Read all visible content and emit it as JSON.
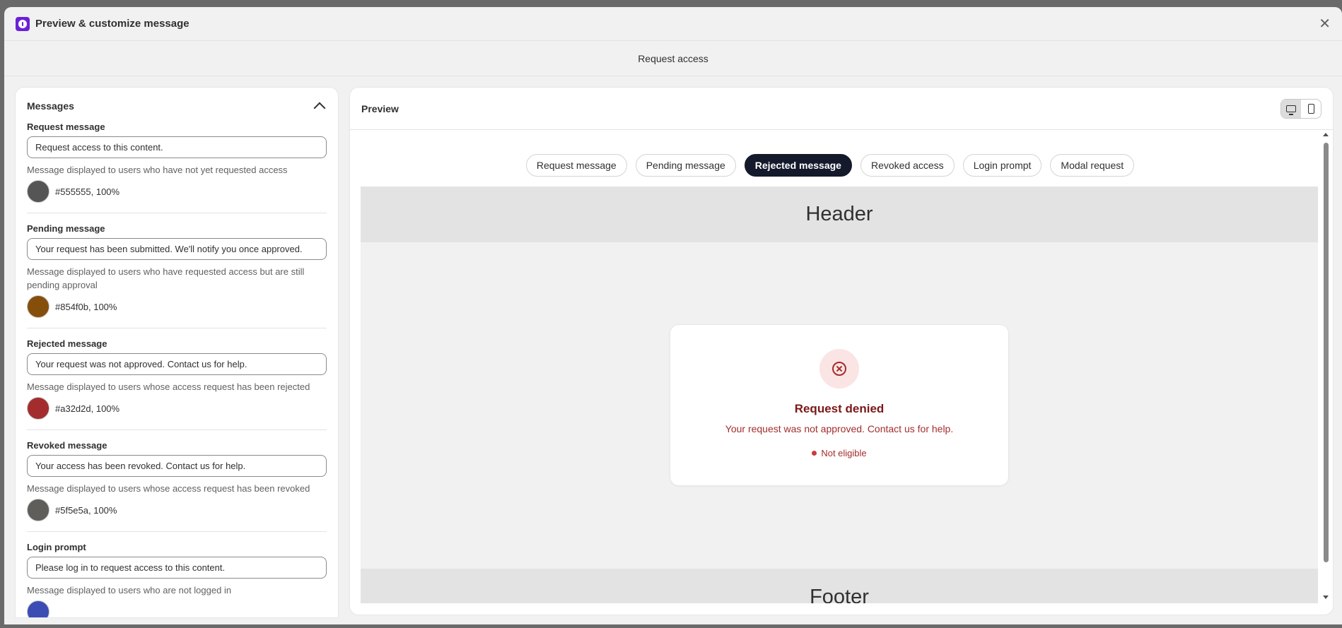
{
  "window": {
    "title": "Preview & customize message",
    "subtitle": "Request access"
  },
  "messages_panel": {
    "heading": "Messages",
    "sections": [
      {
        "label": "Request message",
        "value": "Request access to this content.",
        "help": "Message displayed to users who have not yet requested access",
        "color": "#555555",
        "color_label": "#555555, 100%"
      },
      {
        "label": "Pending message",
        "value": "Your request has been submitted. We'll notify you once approved.",
        "help": "Message displayed to users who have requested access but are still pending approval",
        "color": "#854f0b",
        "color_label": "#854f0b, 100%"
      },
      {
        "label": "Rejected message",
        "value": "Your request was not approved. Contact us for help.",
        "help": "Message displayed to users whose access request has been rejected",
        "color": "#a32d2d",
        "color_label": "#a32d2d, 100%"
      },
      {
        "label": "Revoked message",
        "value": "Your access has been revoked. Contact us for help.",
        "help": "Message displayed to users whose access request has been revoked",
        "color": "#5f5e5a",
        "color_label": "#5f5e5a, 100%"
      },
      {
        "label": "Login prompt",
        "value": "Please log in to request access to this content.",
        "help": "Message displayed to users who are not logged in",
        "color": "#3b4db5"
      }
    ]
  },
  "preview": {
    "heading": "Preview",
    "tabs": [
      "Request message",
      "Pending message",
      "Rejected message",
      "Revoked access",
      "Login prompt",
      "Modal request"
    ],
    "active_tab": "Rejected message",
    "header_text": "Header",
    "footer_text": "Footer",
    "card": {
      "title": "Request denied",
      "message": "Your request was not approved. Contact us for help.",
      "status": "Not eligible"
    }
  },
  "colors": {
    "accent": "#6b21d6",
    "active_tab": "#14192b",
    "error": "#a32d2d"
  }
}
